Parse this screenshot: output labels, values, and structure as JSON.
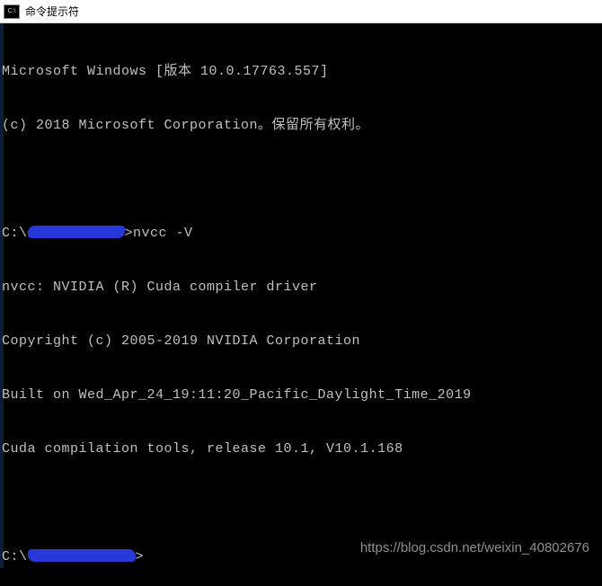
{
  "window": {
    "title": "命令提示符",
    "icon_label": "C:\\"
  },
  "terminal": {
    "lines": {
      "ver1": "Microsoft Windows [版本 10.0.17763.557]",
      "ver2": "(c) 2018 Microsoft Corporation。保留所有权利。",
      "blank1": "",
      "prompt1_prefix": "C:\\",
      "prompt1_suffix": ">nvcc -V",
      "out1": "nvcc: NVIDIA (R) Cuda compiler driver",
      "out2": "Copyright (c) 2005-2019 NVIDIA Corporation",
      "out3": "Built on Wed_Apr_24_19:11:20_Pacific_Daylight_Time_2019",
      "out4": "Cuda compilation tools, release 10.1, V10.1.168",
      "blank2": "",
      "prompt2_prefix": "C:\\",
      "prompt2_suffix": ">"
    }
  },
  "watermark": {
    "text": "https://blog.csdn.net/weixin_40802676"
  }
}
